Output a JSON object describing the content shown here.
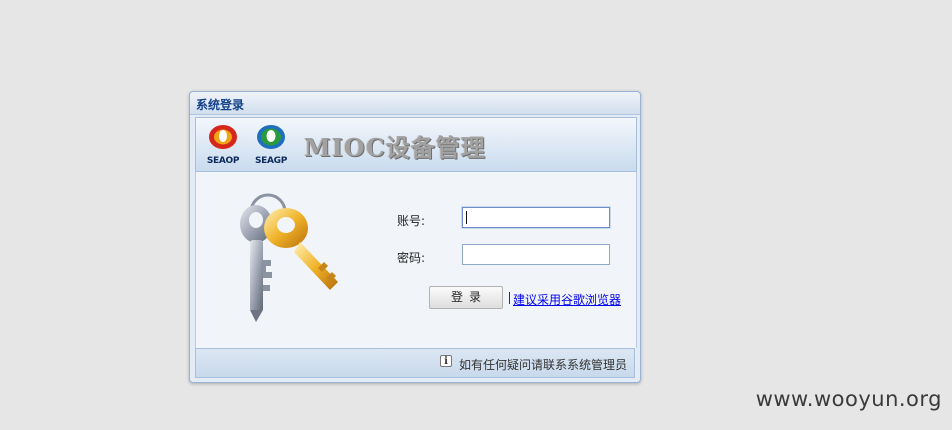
{
  "window": {
    "title": "系统登录"
  },
  "banner": {
    "logos": [
      {
        "caption": "SEAOP",
        "icon": "seaop-logo-icon"
      },
      {
        "caption": "SEAGP",
        "icon": "seagp-logo-icon"
      }
    ],
    "title": "MIOC设备管理"
  },
  "form": {
    "account_label": "账号:",
    "account_value": "",
    "password_label": "密码:",
    "password_value": "",
    "login_button": "登录",
    "browser_tip_link": "建议采用谷歌浏览器"
  },
  "footer": {
    "info_icon_glyph": "i",
    "message": "如有任何疑问请联系系统管理员"
  },
  "watermark": "www.wooyun.org",
  "colors": {
    "title_text": "#15428b",
    "link": "#0000ee",
    "seaop_red": "#d7261c",
    "seaop_orange": "#f2a417",
    "seagp_green": "#2a9a3c",
    "seagp_blue": "#1f6fc0",
    "key_gold": "#e8a21e",
    "key_silver": "#9fa6b4"
  }
}
